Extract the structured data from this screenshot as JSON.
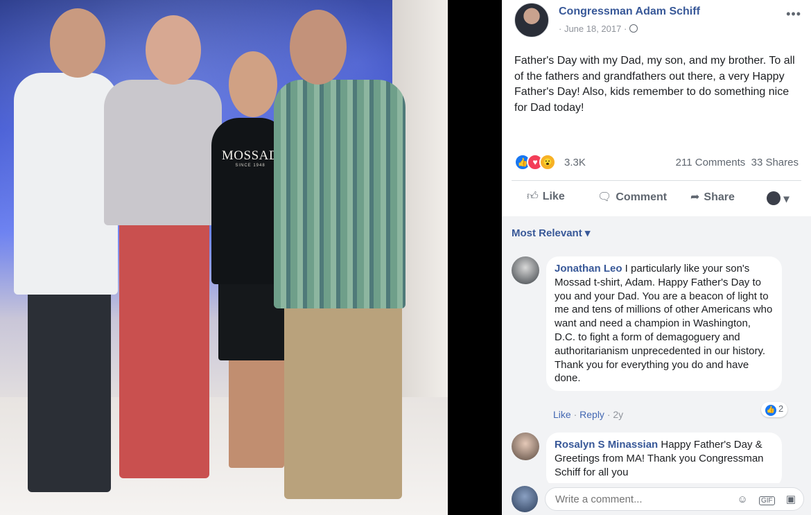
{
  "photo": {
    "shirt_text": "MOSSAD",
    "shirt_subtext": "SINCE 1948"
  },
  "post": {
    "author": "Congressman Adam Schiff",
    "date": "· June 18, 2017 ·",
    "more_icon": "•••",
    "text": "Father's Day with my Dad, my son, and my brother. To all of the fathers and grandfathers out there, a very Happy Father's Day! Also, kids remember to do something nice for Dad today!",
    "reaction_count": "3.3K",
    "comments_count": "211 Comments",
    "shares_count": "33 Shares"
  },
  "actions": {
    "like": "Like",
    "comment": "Comment",
    "share": "Share"
  },
  "sort_label": "Most Relevant ▾",
  "comments": [
    {
      "name": "Jonathan Leo",
      "text": " I particularly like your son's Mossad t-shirt, Adam. Happy Father's Day to you and your Dad. You are a beacon of light to me and tens of millions of other Americans who want and need a champion in Washington, D.C. to fight a form of demagoguery and authoritarianism unprecedented in our history. Thank you for everything you do and have done.",
      "like": "Like",
      "reply": "Reply",
      "age": "2y",
      "reactions": "2"
    },
    {
      "name": "Rosalyn S Minassian",
      "text": " Happy Father's Day & Greetings from MA! Thank you Congressman Schiff for all you"
    }
  ],
  "composer": {
    "placeholder": "Write a comment...",
    "gif": "GIF"
  },
  "colors": {
    "link_blue": "#385898",
    "like_blue": "#1877f2",
    "love_red": "#f33e58",
    "wow_yellow": "#f7b125"
  },
  "icons": [
    "globe-icon",
    "more-icon",
    "like-icon",
    "comment-icon",
    "share-icon",
    "emoji-icon",
    "gif-icon",
    "sticker-icon"
  ]
}
